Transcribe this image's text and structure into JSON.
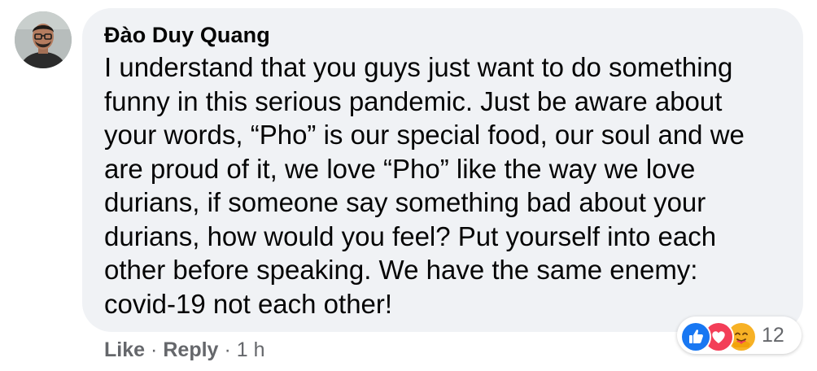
{
  "comment": {
    "author": "Đào Duy Quang",
    "text_lines": [
      "I understand that you guys just want to do something",
      "funny in this serious pandemic. Just be aware about",
      "your words, “Pho” is our special food, our soul and we",
      "are proud of it, we love “Pho” like the way we love",
      "durians, if someone say something bad about your",
      "durians, how would you feel? Put yourself into each",
      "other before speaking. We have the same enemy:",
      "covid-19 not each other!"
    ]
  },
  "actions": {
    "like_label": "Like",
    "separator": "·",
    "reply_label": "Reply",
    "timestamp": "1 h"
  },
  "reactions": {
    "icons": [
      "like-icon",
      "love-icon",
      "care-icon"
    ],
    "count": "12"
  },
  "colors": {
    "bubble_bg": "#f0f2f5",
    "text": "#050505",
    "secondary_text": "#65676b",
    "like_blue": "#1877f2",
    "love_red": "#f33e58",
    "care_yellow": "#f7b125"
  }
}
